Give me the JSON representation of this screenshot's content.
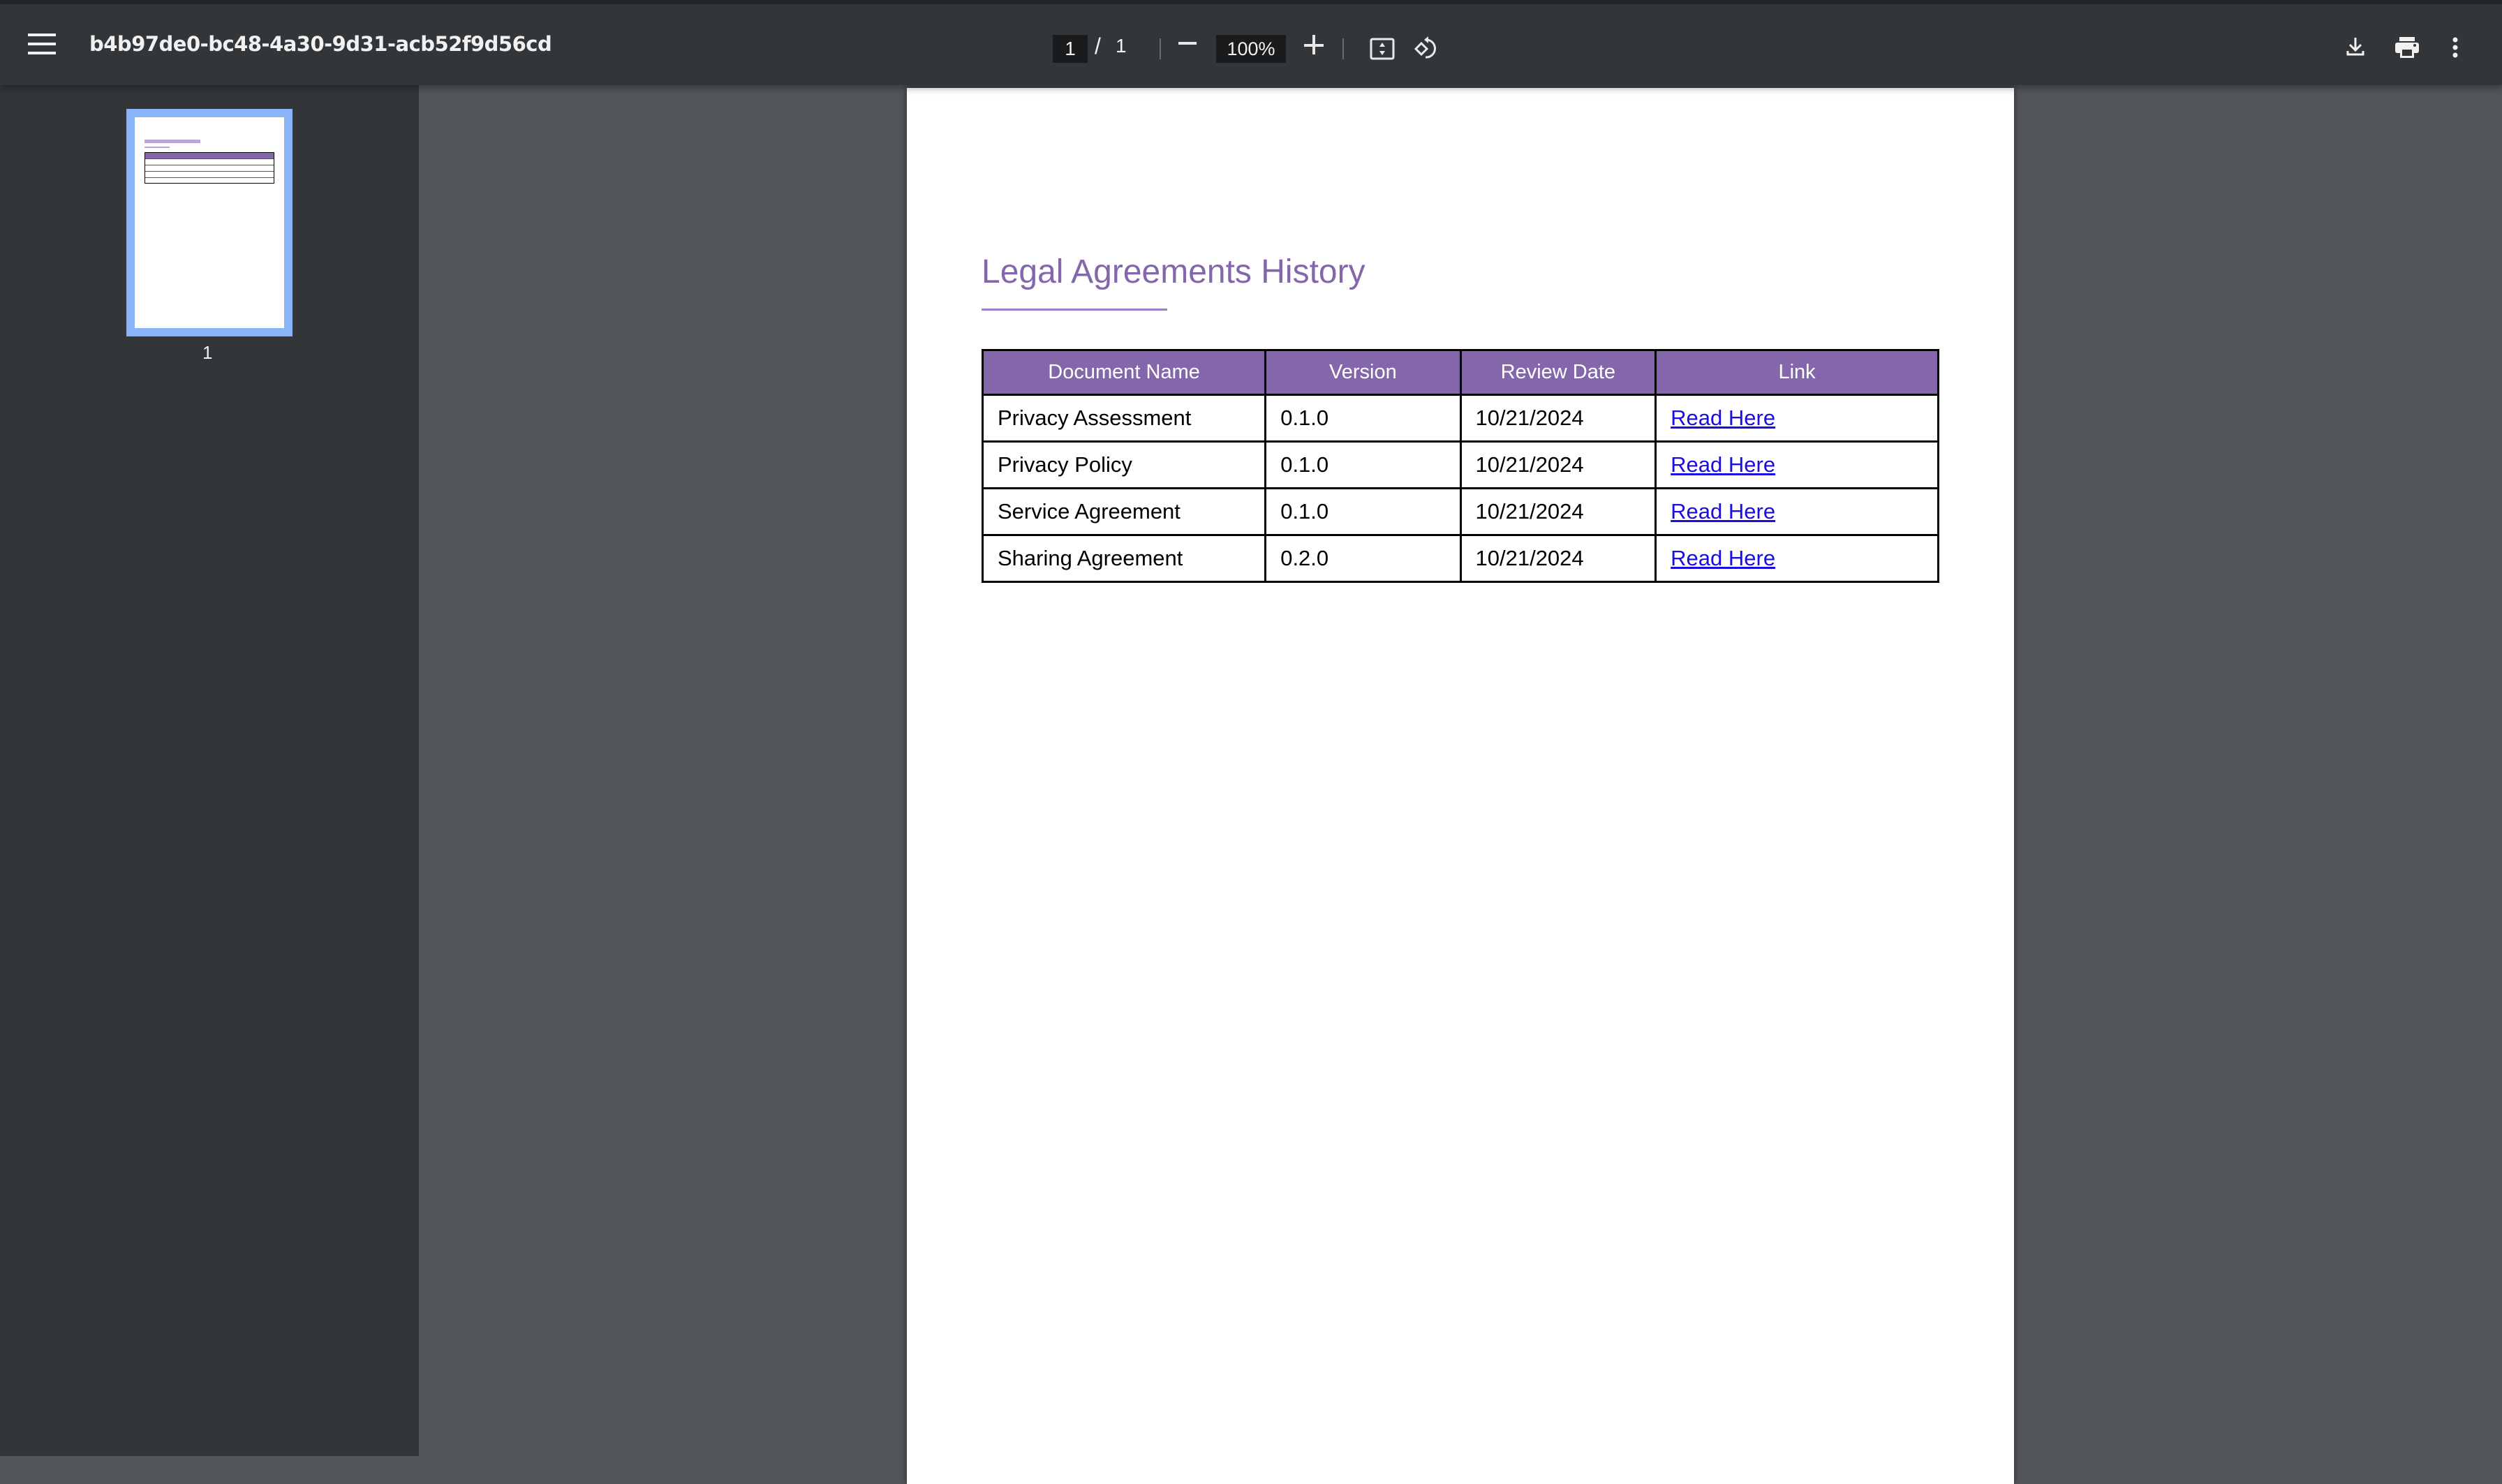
{
  "toolbar": {
    "title": "b4b97de0-bc48-4a30-9d31-acb52f9d56cd",
    "current_page": "1",
    "page_separator": "/",
    "total_pages": "1",
    "zoom_level": "100%",
    "icons": {
      "menu": "hamburger-menu-icon",
      "zoom_out": "minus-icon",
      "zoom_in": "plus-icon",
      "fit": "fit-to-page-icon",
      "rotate": "rotate-counterclockwise-icon",
      "download": "download-icon",
      "print": "print-icon",
      "more": "more-vertical-icon"
    }
  },
  "sidebar": {
    "thumbnails": [
      {
        "label": "1",
        "selected": true
      }
    ]
  },
  "document": {
    "heading": "Legal Agreements History",
    "colors": {
      "accent": "#8467ab",
      "link": "#1a0dde",
      "thumbnail_selected": "#8ab4f8"
    },
    "table": {
      "headers": [
        "Document Name",
        "Version",
        "Review Date",
        "Link"
      ],
      "rows": [
        {
          "name": "Privacy Assessment",
          "version": "0.1.0",
          "review_date": "10/21/2024",
          "link": "Read Here"
        },
        {
          "name": "Privacy Policy",
          "version": "0.1.0",
          "review_date": "10/21/2024",
          "link": "Read Here"
        },
        {
          "name": "Service Agreement",
          "version": "0.1.0",
          "review_date": "10/21/2024",
          "link": "Read Here"
        },
        {
          "name": "Sharing Agreement",
          "version": "0.2.0",
          "review_date": "10/21/2024",
          "link": "Read Here"
        }
      ]
    }
  }
}
